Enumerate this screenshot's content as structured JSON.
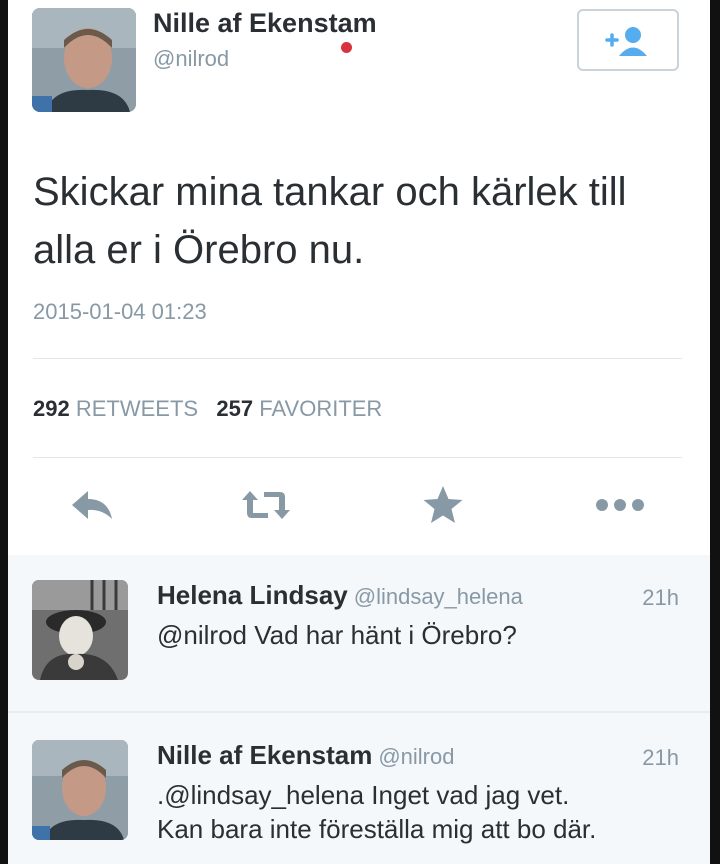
{
  "tweet": {
    "author_name": "Nille af Ekenstam",
    "author_handle": "@nilrod",
    "text": "Skickar mina tankar och kärlek till alla er i Örebro nu.",
    "timestamp": "2015-01-04 01:23",
    "retweets_count": "292",
    "retweets_label": "RETWEETS",
    "favorites_count": "257",
    "favorites_label": "FAVORITER",
    "follow_icon": "add-user-icon",
    "action_icons": [
      "reply-icon",
      "retweet-icon",
      "favorite-star-icon",
      "more-dots-icon"
    ]
  },
  "replies": [
    {
      "name": "Helena Lindsay",
      "handle": "@lindsay_helena",
      "time": "21h",
      "text_line1": "@nilrod Vad har hänt i Örebro?",
      "text_line2": ""
    },
    {
      "name": "Nille af Ekenstam",
      "handle": "@nilrod",
      "time": "21h",
      "text_line1": ".@lindsay_helena Inget vad jag vet.",
      "text_line2": "Kan bara inte föreställa mig att bo där."
    }
  ],
  "colors": {
    "text": "#292f33",
    "muted": "#8899a6",
    "icon": "#8899a6",
    "follow_icon": "#55acee",
    "divider": "#e1e8ed",
    "reply_bg": "#f5f8fa"
  }
}
